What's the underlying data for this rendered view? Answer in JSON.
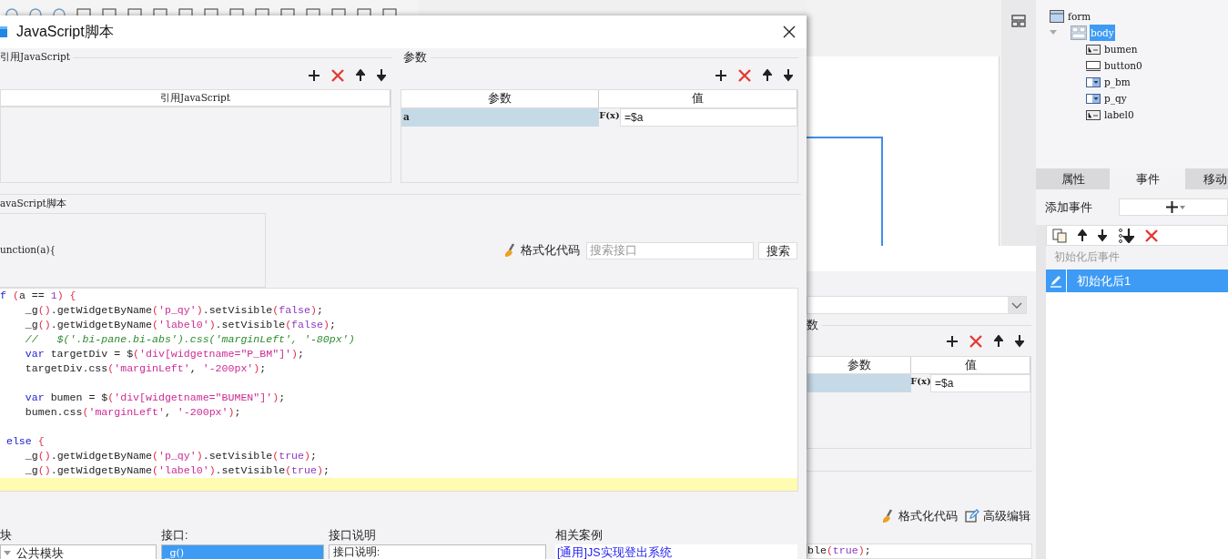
{
  "script_dialog": {
    "title": "JavaScript脚本",
    "ref_section": {
      "label": "引用JavaScript",
      "columns": [
        "引用JavaScript"
      ]
    },
    "params_section": {
      "label": "参数",
      "columns": [
        "参数",
        "值"
      ],
      "fx_label": "F(x)",
      "rows": [
        {
          "name": "a",
          "value": "=$a",
          "selected": true
        }
      ]
    },
    "script_section": {
      "label": "avaScript脚本",
      "signature": "unction(a){",
      "format_label": "格式化代码",
      "search_placeholder": "搜索接口",
      "search_button": "搜索"
    },
    "code_lines": [
      {
        "current": false,
        "tokens": [
          {
            "kind": "kw",
            "text": "f"
          },
          {
            "kind": "punc",
            "text": " ("
          },
          {
            "kind": "txt",
            "text": "a == "
          },
          {
            "kind": "num",
            "text": "1"
          },
          {
            "kind": "punc",
            "text": ")"
          },
          {
            "kind": "punc",
            "text": " {"
          }
        ]
      },
      {
        "current": false,
        "tokens": [
          {
            "kind": "txt",
            "text": "    _g"
          },
          {
            "kind": "punc",
            "text": "()"
          },
          {
            "kind": "txt",
            "text": ".getWidgetByName"
          },
          {
            "kind": "punc",
            "text": "("
          },
          {
            "kind": "str",
            "text": "'p_qy'"
          },
          {
            "kind": "punc",
            "text": ")"
          },
          {
            "kind": "txt",
            "text": ".setVisible"
          },
          {
            "kind": "punc",
            "text": "("
          },
          {
            "kind": "bool",
            "text": "false"
          },
          {
            "kind": "punc",
            "text": ")"
          },
          {
            "kind": "txt",
            "text": ";"
          }
        ]
      },
      {
        "current": false,
        "tokens": [
          {
            "kind": "txt",
            "text": "    _g"
          },
          {
            "kind": "punc",
            "text": "()"
          },
          {
            "kind": "txt",
            "text": ".getWidgetByName"
          },
          {
            "kind": "punc",
            "text": "("
          },
          {
            "kind": "str",
            "text": "'label0'"
          },
          {
            "kind": "punc",
            "text": ")"
          },
          {
            "kind": "txt",
            "text": ".setVisible"
          },
          {
            "kind": "punc",
            "text": "("
          },
          {
            "kind": "bool",
            "text": "false"
          },
          {
            "kind": "punc",
            "text": ")"
          },
          {
            "kind": "txt",
            "text": ";"
          }
        ]
      },
      {
        "current": false,
        "tokens": [
          {
            "kind": "cmt",
            "text": "    //   $('.bi-pane.bi-abs').css('marginLeft', '-80px')"
          }
        ]
      },
      {
        "current": false,
        "tokens": [
          {
            "kind": "kw",
            "text": "    var"
          },
          {
            "kind": "txt",
            "text": " targetDiv = $"
          },
          {
            "kind": "punc",
            "text": "("
          },
          {
            "kind": "str",
            "text": "'div[widgetname=\"P_BM\"]'"
          },
          {
            "kind": "punc",
            "text": ")"
          },
          {
            "kind": "txt",
            "text": ";"
          }
        ]
      },
      {
        "current": false,
        "tokens": [
          {
            "kind": "txt",
            "text": "    targetDiv.css"
          },
          {
            "kind": "punc",
            "text": "("
          },
          {
            "kind": "str",
            "text": "'marginLeft'"
          },
          {
            "kind": "txt",
            "text": ", "
          },
          {
            "kind": "str",
            "text": "'-200px'"
          },
          {
            "kind": "punc",
            "text": ")"
          },
          {
            "kind": "txt",
            "text": ";"
          }
        ]
      },
      {
        "current": false
      },
      {
        "current": false,
        "tokens": [
          {
            "kind": "kw",
            "text": "    var"
          },
          {
            "kind": "txt",
            "text": " bumen = $"
          },
          {
            "kind": "punc",
            "text": "("
          },
          {
            "kind": "str",
            "text": "'div[widgetname=\"BUMEN\"]'"
          },
          {
            "kind": "punc",
            "text": ")"
          },
          {
            "kind": "txt",
            "text": ";"
          }
        ]
      },
      {
        "current": false,
        "tokens": [
          {
            "kind": "txt",
            "text": "    bumen.css"
          },
          {
            "kind": "punc",
            "text": "("
          },
          {
            "kind": "str",
            "text": "'marginLeft'"
          },
          {
            "kind": "txt",
            "text": ", "
          },
          {
            "kind": "str",
            "text": "'-200px'"
          },
          {
            "kind": "punc",
            "text": ")"
          },
          {
            "kind": "txt",
            "text": ";"
          }
        ]
      },
      {
        "current": false
      },
      {
        "current": false,
        "tokens": [
          {
            "kind": "kw",
            "text": " else"
          },
          {
            "kind": "punc",
            "text": " {"
          }
        ]
      },
      {
        "current": false,
        "tokens": [
          {
            "kind": "txt",
            "text": "    _g"
          },
          {
            "kind": "punc",
            "text": "()"
          },
          {
            "kind": "txt",
            "text": ".getWidgetByName"
          },
          {
            "kind": "punc",
            "text": "("
          },
          {
            "kind": "str",
            "text": "'p_qy'"
          },
          {
            "kind": "punc",
            "text": ")"
          },
          {
            "kind": "txt",
            "text": ".setVisible"
          },
          {
            "kind": "punc",
            "text": "("
          },
          {
            "kind": "bool",
            "text": "true"
          },
          {
            "kind": "punc",
            "text": ")"
          },
          {
            "kind": "txt",
            "text": ";"
          }
        ]
      },
      {
        "current": false,
        "tokens": [
          {
            "kind": "txt",
            "text": "    _g"
          },
          {
            "kind": "punc",
            "text": "()"
          },
          {
            "kind": "txt",
            "text": ".getWidgetByName"
          },
          {
            "kind": "punc",
            "text": "("
          },
          {
            "kind": "str",
            "text": "'label0'"
          },
          {
            "kind": "punc",
            "text": ")"
          },
          {
            "kind": "txt",
            "text": ".setVisible"
          },
          {
            "kind": "punc",
            "text": "("
          },
          {
            "kind": "bool",
            "text": "true"
          },
          {
            "kind": "punc",
            "text": ")"
          },
          {
            "kind": "txt",
            "text": ";"
          }
        ]
      },
      {
        "current": true
      }
    ],
    "api_browser": {
      "module_label": "块",
      "modules": [
        {
          "label": "公共模块",
          "expanded": true
        }
      ],
      "api_label": "接口:",
      "apis": [
        {
          "label": "_g()",
          "selected": true
        }
      ],
      "desc_label": "接口说明",
      "desc_text": "接口说明:",
      "cases_label": "相关案例",
      "cases": [
        "[通用]JS实现登出系统"
      ]
    }
  },
  "event_dialog": {
    "param_label": "数",
    "columns": [
      "参数",
      "值"
    ],
    "fx_label": "F(x)",
    "rows": [
      {
        "value": "=$a",
        "selected": true
      }
    ],
    "format_label": "格式化代码",
    "advanced_label": "高级编辑",
    "code_tokens": [
      {
        "kind": "txt",
        "text": "ble"
      },
      {
        "kind": "punc",
        "text": "("
      },
      {
        "kind": "bool",
        "text": "true"
      },
      {
        "kind": "punc",
        "text": ")"
      },
      {
        "kind": "txt",
        "text": ";"
      }
    ]
  },
  "widget_tree": [
    {
      "label": "form",
      "kind": "form",
      "selected": false,
      "children": [
        {
          "label": "body",
          "kind": "layout",
          "selected": true,
          "expanded": true,
          "children": [
            {
              "label": "bumen",
              "kind": "label",
              "selected": false
            },
            {
              "label": "button0",
              "kind": "button",
              "selected": false
            },
            {
              "label": "p_bm",
              "kind": "combo",
              "selected": false
            },
            {
              "label": "p_qy",
              "kind": "combo",
              "selected": false
            },
            {
              "label": "label0",
              "kind": "label",
              "selected": false
            }
          ]
        }
      ]
    }
  ],
  "property_tabs": [
    {
      "label": "属性",
      "selected": false
    },
    {
      "label": "事件",
      "selected": true
    },
    {
      "label": "移动",
      "selected": false
    }
  ],
  "events": {
    "add_label": "添加事件",
    "group_label": "初始化后事件",
    "items": [
      {
        "label": "初始化后1",
        "selected": true
      }
    ]
  }
}
